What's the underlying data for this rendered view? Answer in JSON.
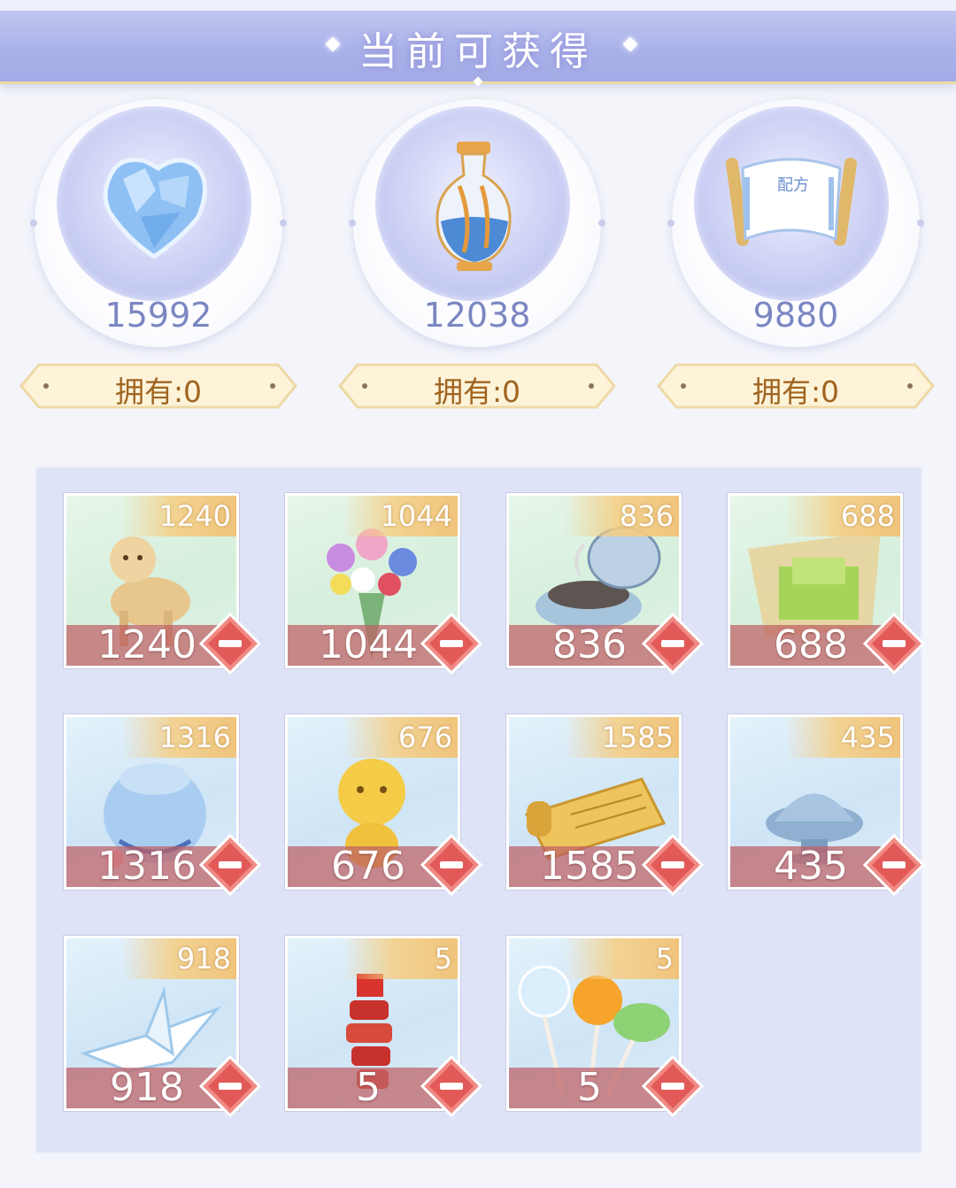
{
  "header": {
    "title": "当前可获得"
  },
  "currencies": [
    {
      "icon": "blue-crystal-icon",
      "amount": "15992",
      "owned": "拥有:0"
    },
    {
      "icon": "porcelain-vase-icon",
      "amount": "12038",
      "owned": "拥有:0"
    },
    {
      "icon": "recipe-scroll-icon",
      "amount": "9880",
      "owned": "拥有:0",
      "scroll_text": "配方"
    }
  ],
  "items": [
    {
      "icon": "wooden-alpaca-icon",
      "available": "1240",
      "selected": "1240",
      "bg": "green"
    },
    {
      "icon": "flower-bouquet-icon",
      "available": "1044",
      "selected": "1044",
      "bg": "green"
    },
    {
      "icon": "incense-burner-icon",
      "available": "836",
      "selected": "836",
      "bg": "green"
    },
    {
      "icon": "green-tea-basket-icon",
      "available": "688",
      "selected": "688",
      "bg": "green"
    },
    {
      "icon": "cloth-pouch-icon",
      "available": "1316",
      "selected": "1316",
      "bg": "blue"
    },
    {
      "icon": "golden-alpaca-icon",
      "available": "676",
      "selected": "676",
      "bg": "blue"
    },
    {
      "icon": "golden-scroll-icon",
      "available": "1585",
      "selected": "1585",
      "bg": "blue"
    },
    {
      "icon": "incense-lid-icon",
      "available": "435",
      "selected": "435",
      "bg": "blue"
    },
    {
      "icon": "paper-crane-icon",
      "available": "918",
      "selected": "918",
      "bg": "blue"
    },
    {
      "icon": "firecracker-icon",
      "available": "5",
      "selected": "5",
      "bg": "blue"
    },
    {
      "icon": "candy-lollipop-icon",
      "available": "5",
      "selected": "5",
      "bg": "blue"
    }
  ],
  "colors": {
    "accent_gold": "#f0c47c",
    "minus_red": "#e96a6a",
    "amount_blue": "#7b87c2"
  }
}
